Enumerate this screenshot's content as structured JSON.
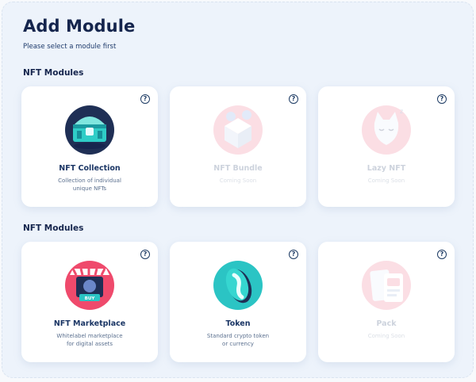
{
  "header": {
    "title": "Add Module",
    "subtitle": "Please select a module first"
  },
  "sections": [
    {
      "title": "NFT Modules",
      "cards": [
        {
          "name": "NFT Collection",
          "desc1": "Collection of individual",
          "desc2": "unique NFTs",
          "enabled": true,
          "icon": "treasure-chest-icon"
        },
        {
          "name": "NFT Bundle",
          "desc1": "Coming Soon",
          "desc2": "",
          "enabled": false,
          "icon": "bundle-box-icon"
        },
        {
          "name": "Lazy NFT",
          "desc1": "Coming Soon",
          "desc2": "",
          "enabled": false,
          "icon": "sleeping-cat-icon"
        }
      ]
    },
    {
      "title": "NFT Modules",
      "cards": [
        {
          "name": "NFT Marketplace",
          "desc1": "Whitelabel marketplace",
          "desc2": "for digital assets",
          "enabled": true,
          "icon": "storefront-icon",
          "buy_label": "BUY"
        },
        {
          "name": "Token",
          "desc1": "Standard crypto token",
          "desc2": "or currency",
          "enabled": true,
          "icon": "coin-icon"
        },
        {
          "name": "Pack",
          "desc1": "Coming Soon",
          "desc2": "",
          "enabled": false,
          "icon": "card-pack-icon"
        }
      ]
    }
  ],
  "help_glyph": "?",
  "colors": {
    "title": "#15254d",
    "accent_teal": "#2bc4c4",
    "accent_pink": "#ef4a6c",
    "panel_bg": "#edf3fb"
  }
}
